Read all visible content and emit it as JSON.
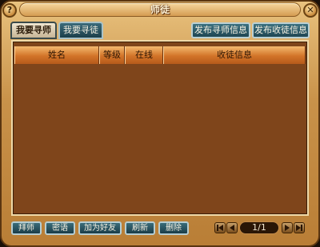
{
  "window": {
    "title": "师徒",
    "help_label": "?",
    "close_label": "✕"
  },
  "tabs": [
    {
      "label": "我要寻师",
      "active": true
    },
    {
      "label": "我要寻徒",
      "active": false
    }
  ],
  "publish_buttons": {
    "master_info": "发布寻师信息",
    "apprentice_info": "发布收徒信息"
  },
  "table": {
    "columns": [
      "姓名",
      "等级",
      "在线",
      "收徒信息"
    ],
    "rows": []
  },
  "actions": {
    "bai_shi": "拜师",
    "mi_yu": "密语",
    "add_friend": "加为好友",
    "refresh": "刷新",
    "delete": "删除"
  },
  "pagination": {
    "page_text": "1/1"
  },
  "colors": {
    "panel": "#7f451b",
    "header": "#d27428",
    "button": "#2a5866"
  }
}
